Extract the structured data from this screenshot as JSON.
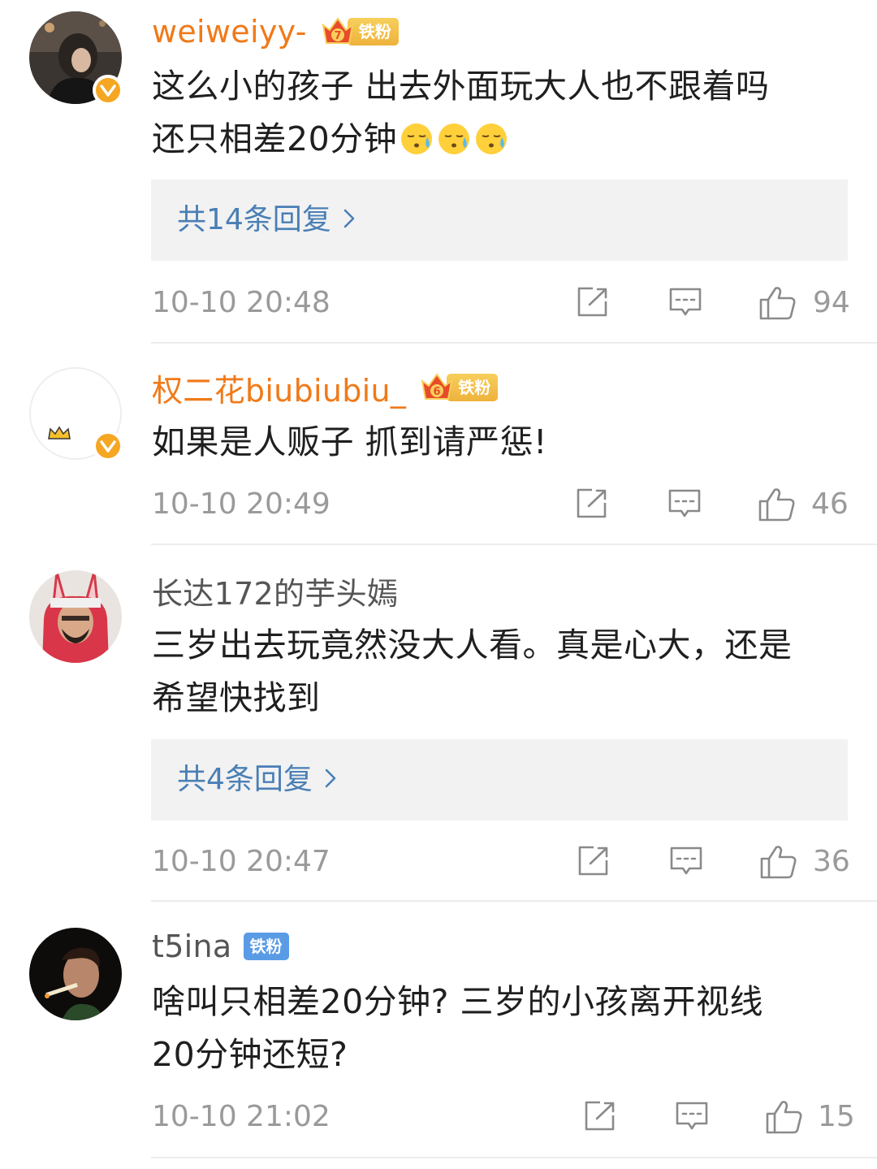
{
  "comments": [
    {
      "username": "weiweiyy-",
      "fan_badge": "铁粉",
      "fan_level": "7",
      "text_lines": [
        "这么小的孩子 出去外面玩大人也不跟着吗",
        "还只相差20分钟"
      ],
      "emoji": [
        "sweat-emoji",
        "sweat-emoji",
        "sweat-emoji"
      ],
      "reply_label": "共14条回复",
      "time": "10-10 20:48",
      "likes": "94"
    },
    {
      "username": "权二花biubiubiu_",
      "fan_badge": "铁粉",
      "fan_level": "6",
      "text_lines": [
        "如果是人贩子 抓到请严惩!"
      ],
      "time": "10-10 20:49",
      "likes": "46"
    },
    {
      "username": "长达172的芋头嫣",
      "text_lines": [
        "三岁出去玩竟然没大人看。真是心大，还是",
        "希望快找到"
      ],
      "reply_label": "共4条回复",
      "time": "10-10 20:47",
      "likes": "36"
    },
    {
      "username": "t5ina",
      "fan_badge": "铁粉",
      "text_lines": [
        "啥叫只相差20分钟? 三岁的小孩离开视线",
        "20分钟还短?"
      ],
      "time": "10-10 21:02",
      "likes": "15"
    }
  ],
  "colors": {
    "vip_name": "#f07a1a",
    "reply_link": "#4a7fb5",
    "meta_gray": "#9a9a9a",
    "verified_badge": "#f5a623",
    "fan_badge_blue": "#5a9be6"
  },
  "icons": [
    "share-icon",
    "comment-icon",
    "like-icon",
    "chevron-right-icon",
    "verified-badge-icon",
    "crown-icon"
  ]
}
